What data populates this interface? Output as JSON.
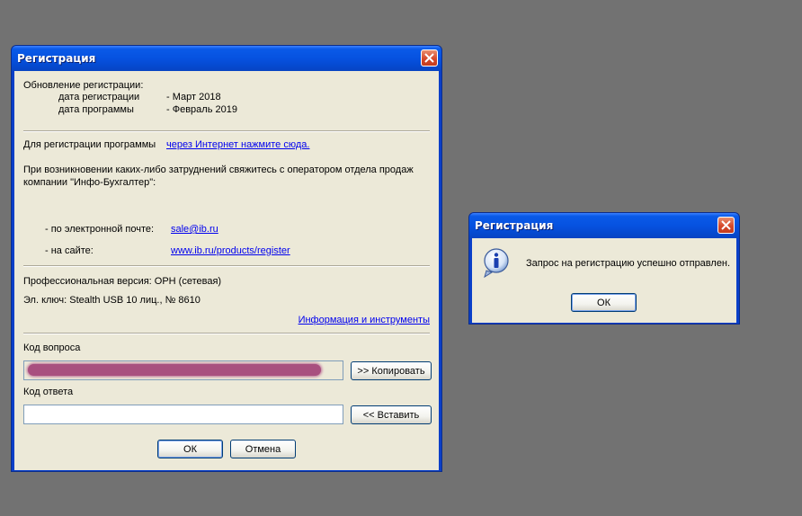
{
  "main_dialog": {
    "title": "Регистрация",
    "update_heading": "Обновление регистрации:",
    "reg_date_label": "дата регистрации",
    "reg_date_value": "- Март 2018",
    "prog_date_label": "дата программы",
    "prog_date_value": "- Февраль 2019",
    "register_prompt": "Для регистрации программы",
    "register_link": "через Интернет нажмите сюда.",
    "contact_line1": "При возникновении каких-либо затруднений свяжитесь с оператором отдела продаж",
    "contact_line2": "компании \"Инфо-Бухгалтер\":",
    "email_label": "- по электронной почте:",
    "email_link": "sale@ib.ru",
    "site_label": "- на сайте:",
    "site_link": "www.ib.ru/products/register",
    "version_text": "Профессиональная версия: ОРН (сетевая)",
    "key_text": "Эл. ключ: Stealth USB 10 лиц., № 8610",
    "info_link": "Информация и инструменты",
    "question_code_label": "Код вопроса",
    "copy_button": ">> Копировать",
    "answer_code_label": "Код ответа",
    "answer_code_value": "",
    "paste_button": "<< Вставить",
    "ok_button": "ОК",
    "cancel_button": "Отмена"
  },
  "message_box": {
    "title": "Регистрация",
    "message": "Запрос на регистрацию успешно отправлен.",
    "ok_button": "ОК",
    "icon": "info-icon"
  },
  "colors": {
    "desktop": "#727272",
    "titlebar": "#0652e0",
    "dialog_face": "#ece9d8",
    "link": "#0000ee",
    "redaction": "#a34278"
  }
}
